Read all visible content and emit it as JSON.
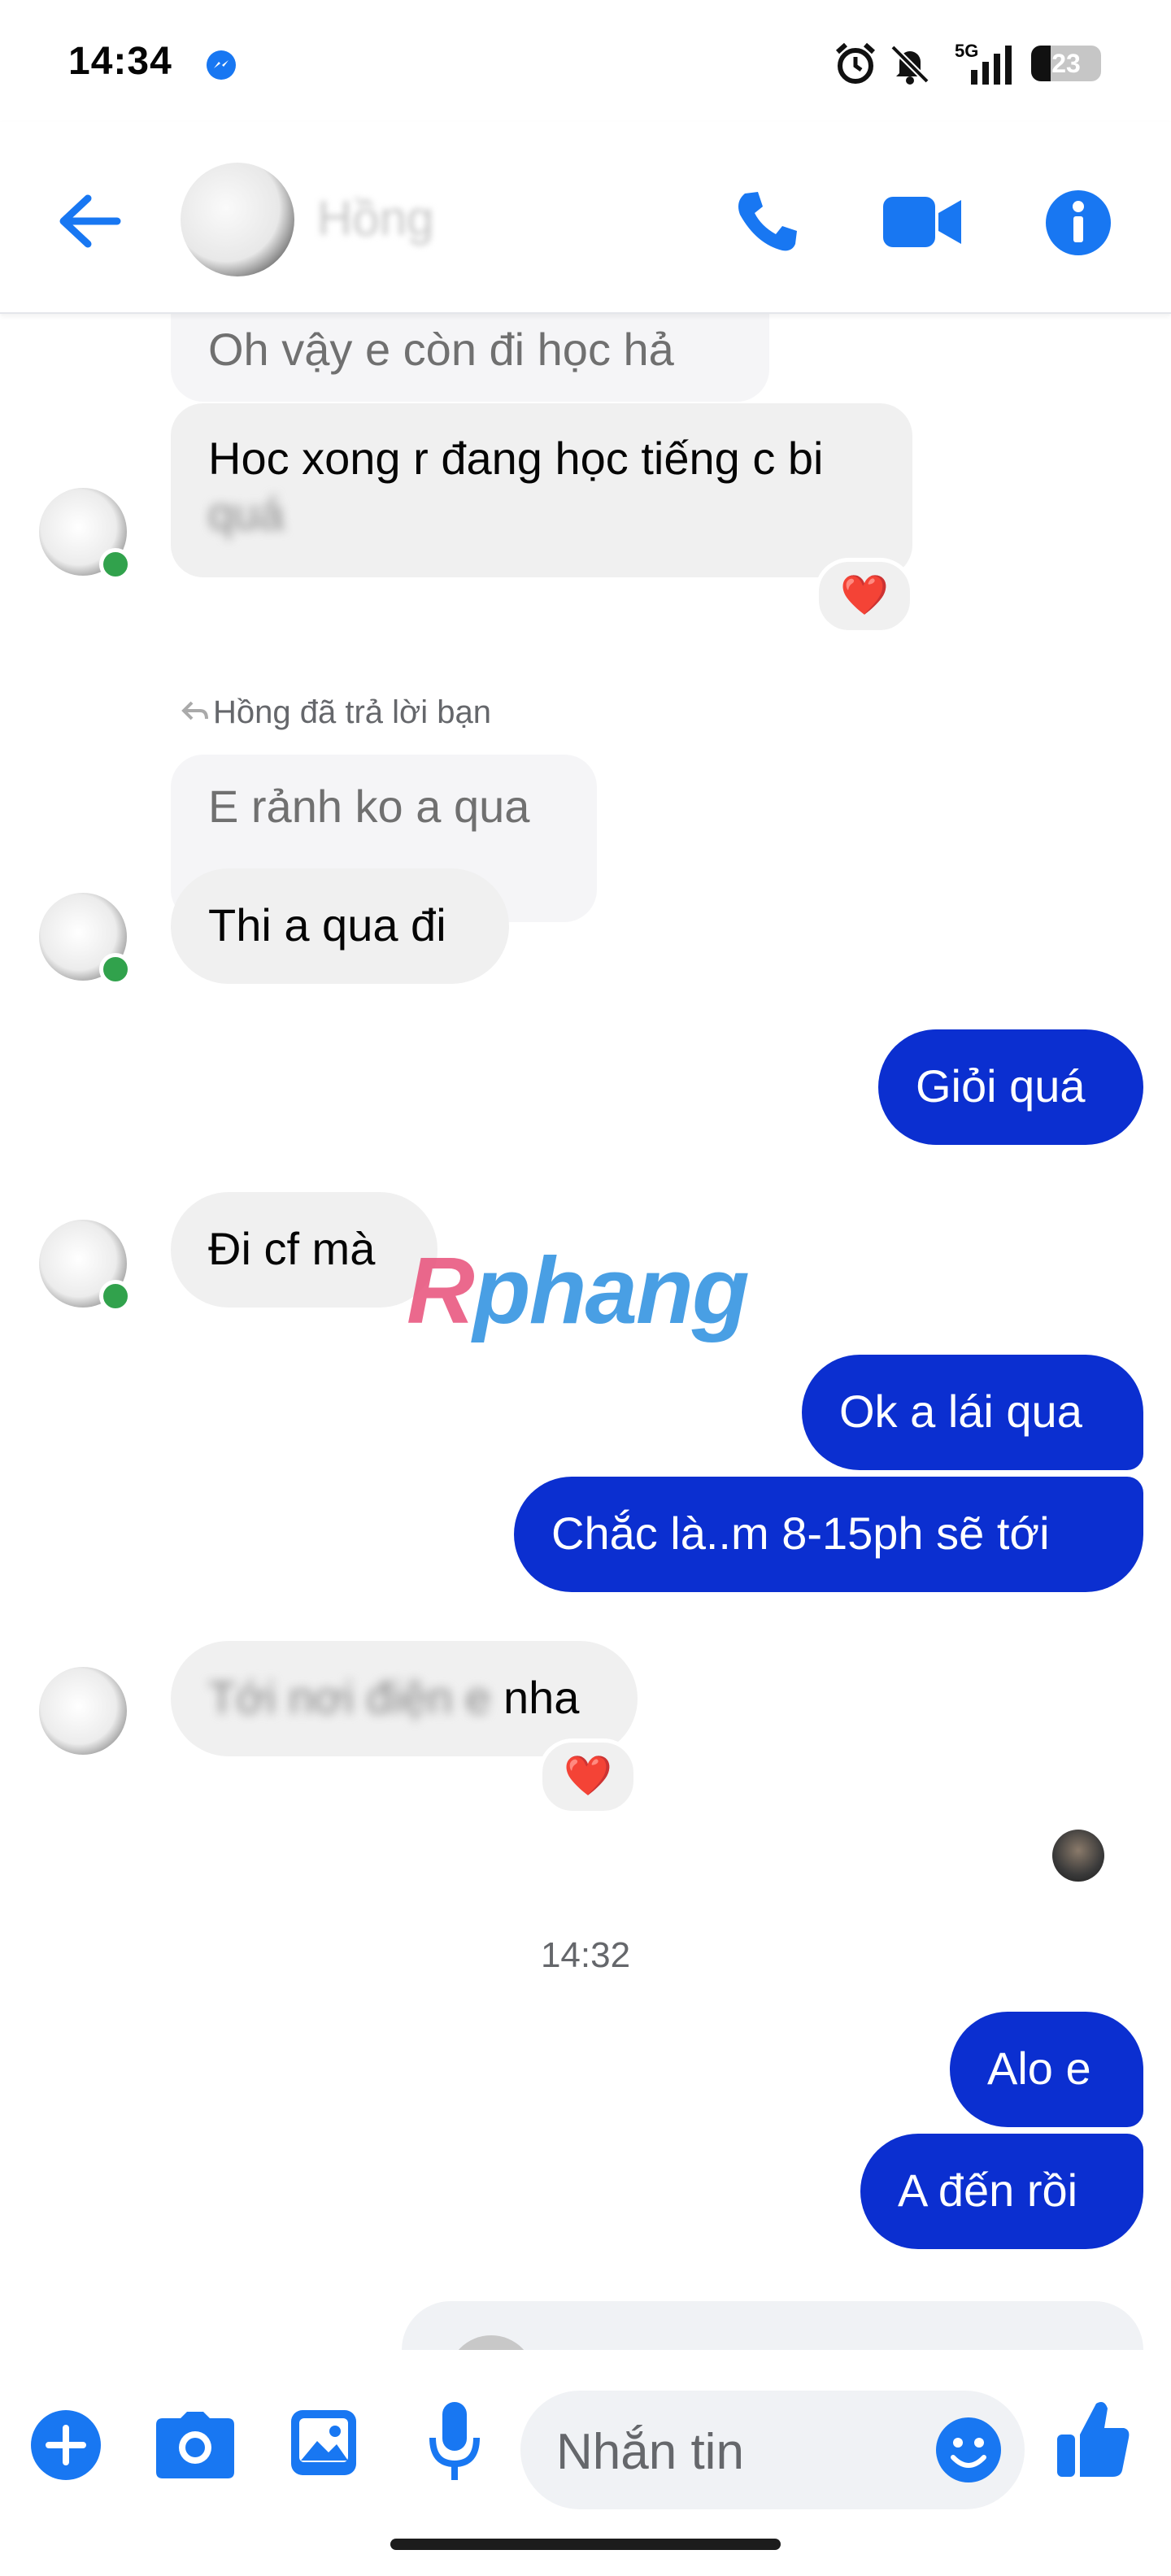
{
  "status_bar": {
    "time": "14:34",
    "network": "5G",
    "battery": "23"
  },
  "header": {
    "contact_name": "Hồng",
    "icons": [
      "back-arrow-icon",
      "phone-icon",
      "video-camera-icon",
      "info-icon"
    ],
    "accent": "#1877f2"
  },
  "messages": {
    "m1": "Oh vậy e còn đi học hả",
    "m2_line1": "Hoc xong r đang học tiếng c bi",
    "m2_line2": "quá",
    "reply_label": "Hồng đã trả lời bạn",
    "m3_quote": "E rảnh ko a qua",
    "m4": "Thi a qua đi",
    "m5": "Giỏi quá",
    "m6": "Đi cf mà",
    "m7": "Ok a lái qua",
    "m8": "Chắc là..m 8-15ph sẽ tới",
    "m9_blurred": "Tới nơi điện e",
    "m9_visible": "nha",
    "timestamp": "14:32",
    "m10": "Alo e",
    "m11": "A đến rồi",
    "reaction": "❤️"
  },
  "watermark": {
    "r": "R",
    "rest": "phang"
  },
  "composer": {
    "placeholder": "Nhắn tin",
    "icons": [
      "plus-icon",
      "camera-icon",
      "image-icon",
      "microphone-icon",
      "emoji-icon",
      "thumbs-up-icon"
    ]
  },
  "colors": {
    "outgoing": "#0b2fd0",
    "incoming": "#f0f0f0",
    "online": "#31a24c",
    "accent": "#1877f2"
  }
}
